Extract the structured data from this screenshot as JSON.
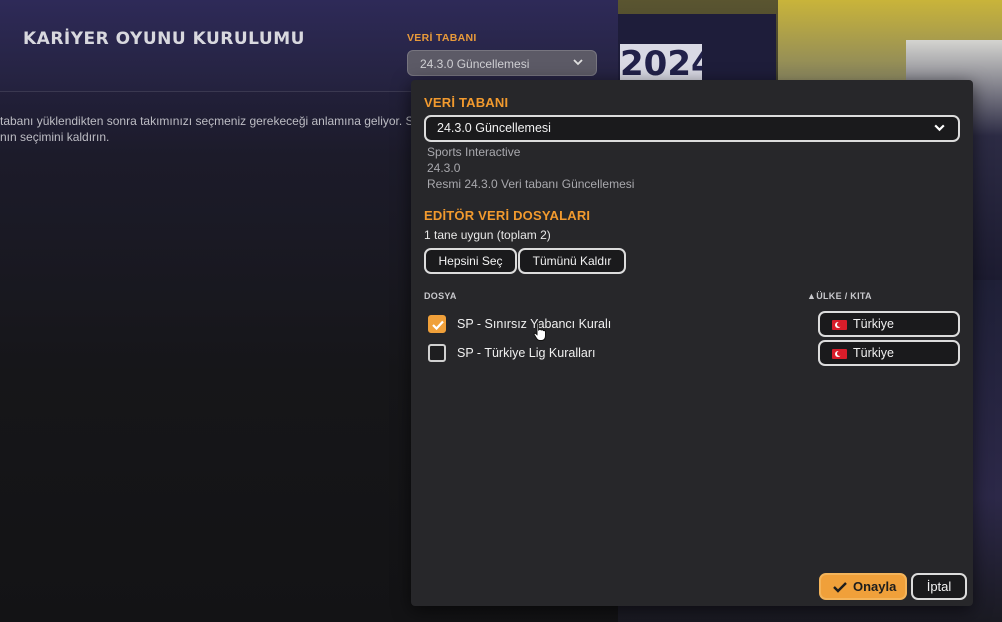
{
  "page": {
    "title": "KARİYER OYUNU KURULUMU",
    "db_label": "VERİ TABANI",
    "db_value": "24.3.0 Güncellemesi",
    "info_line1": "tabanı yüklendikten sonra takımınızı seçmeniz gerekeceği anlamına geliyor. S",
    "info_line2": "nın seçimini kaldırın.",
    "banner_year": "2024"
  },
  "modal": {
    "database": {
      "title": "VERİ TABANI",
      "selected": "24.3.0 Güncellemesi",
      "publisher": "Sports Interactive",
      "version": "24.3.0",
      "description": "Resmi 24.3.0 Veri tabanı Güncellemesi"
    },
    "editor": {
      "title": "EDİTÖR VERİ DOSYALARI",
      "available": "1 tane uygun (toplam 2)",
      "select_all": "Hepsini Seç",
      "deselect_all": "Tümünü Kaldır",
      "col_file": "DOSYA",
      "col_country": "▲ÜLKE / KITA",
      "files": [
        {
          "name": "SP - Sınırsız Yabancı Kuralı",
          "checked": true,
          "country": "Türkiye"
        },
        {
          "name": "SP - Türkiye Lig Kuralları",
          "checked": false,
          "country": "Türkiye"
        }
      ]
    },
    "confirm": "Onayla",
    "cancel": "İptal"
  },
  "colors": {
    "accent": "#f29a2e",
    "modal_bg": "#27272a",
    "checkbox_checked": "#f0a03a"
  }
}
